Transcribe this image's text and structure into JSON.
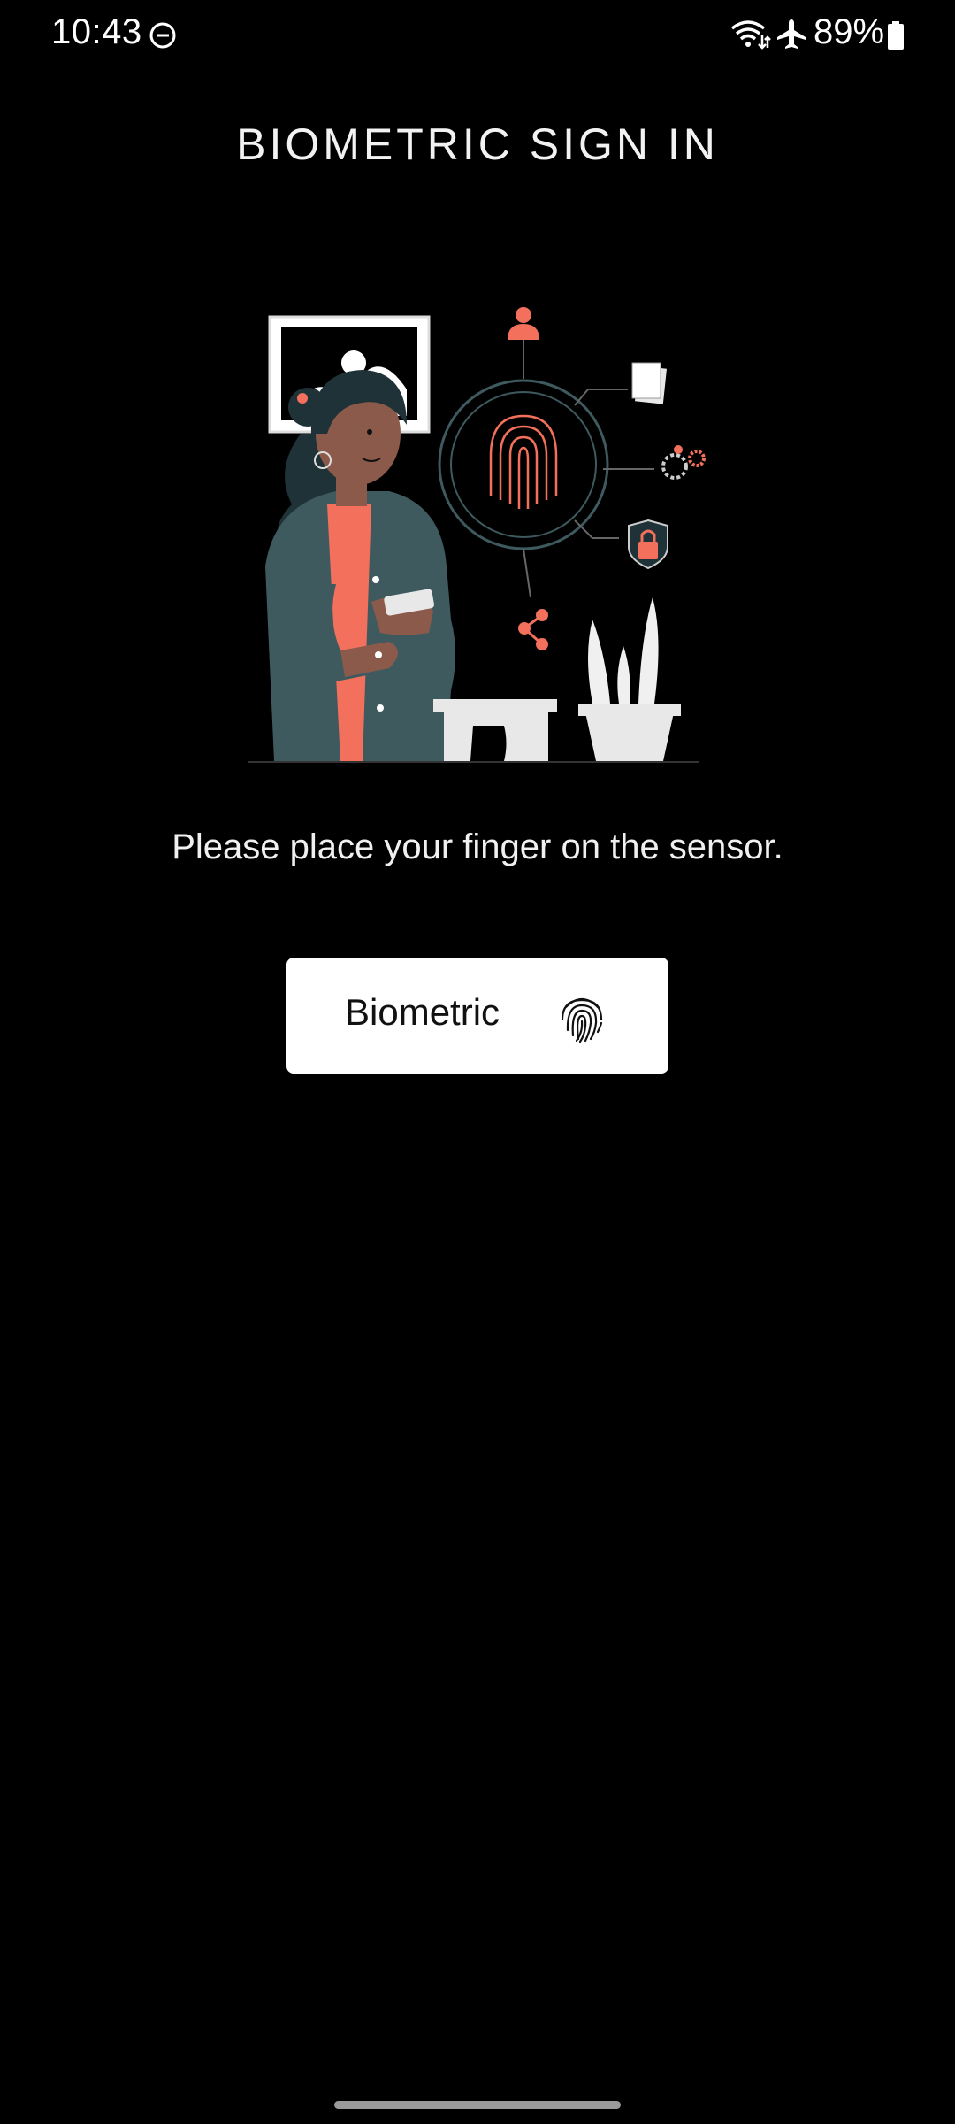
{
  "status_bar": {
    "time": "10:43",
    "battery": "89%",
    "icons": [
      "dnd-icon",
      "wifi-icon",
      "airplane-icon",
      "battery-icon"
    ]
  },
  "title": "BIOMETRIC SIGN IN",
  "instruction": "Please place your finger on the sensor.",
  "button": {
    "label": "Biometric",
    "icon": "fingerprint-icon"
  },
  "colors": {
    "background": "#000000",
    "accent": "#F2705C",
    "illustration_dark": "#3E5A5E",
    "button_bg": "#FFFFFF"
  }
}
